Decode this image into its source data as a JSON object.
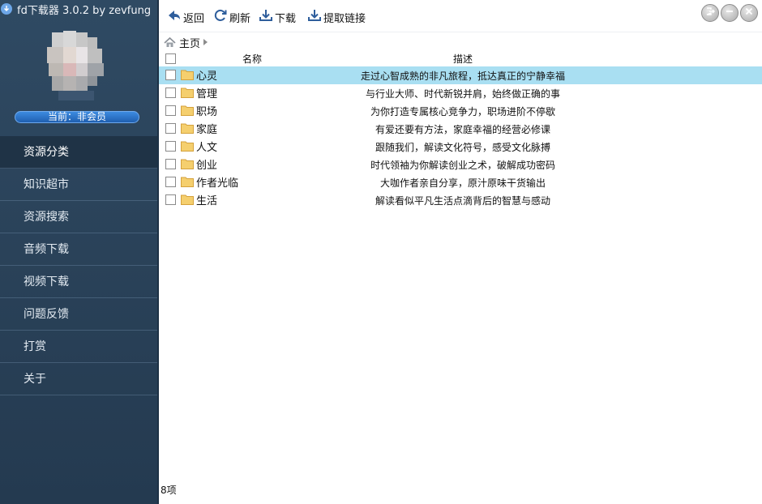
{
  "app": {
    "title": "fd下载器 3.0.2 by zevfung",
    "member_status": "当前：非会员"
  },
  "sidebar": {
    "items": [
      {
        "label": "资源分类",
        "active": true
      },
      {
        "label": "知识超市",
        "active": false
      },
      {
        "label": "资源搜索",
        "active": false
      },
      {
        "label": "音频下载",
        "active": false
      },
      {
        "label": "视频下载",
        "active": false
      },
      {
        "label": "问题反馈",
        "active": false
      },
      {
        "label": "打赏",
        "active": false
      },
      {
        "label": "关于",
        "active": false
      }
    ]
  },
  "toolbar": {
    "back_label": "返回",
    "refresh_label": "刷新",
    "download_label": "下载",
    "extract_label": "提取链接"
  },
  "breadcrumb": {
    "home_label": "主页"
  },
  "table": {
    "columns": [
      "名称",
      "描述"
    ],
    "rows": [
      {
        "name": "心灵",
        "desc": "走过心智成熟的非凡旅程，抵达真正的宁静幸福",
        "selected": true
      },
      {
        "name": "管理",
        "desc": "与行业大师、时代新锐并肩，始终做正确的事",
        "selected": false
      },
      {
        "name": "职场",
        "desc": "为你打造专属核心竞争力，职场进阶不停歇",
        "selected": false
      },
      {
        "name": "家庭",
        "desc": "有爱还要有方法，家庭幸福的经营必修课",
        "selected": false
      },
      {
        "name": "人文",
        "desc": "跟随我们，解读文化符号，感受文化脉搏",
        "selected": false
      },
      {
        "name": "创业",
        "desc": "时代领袖为你解读创业之术，破解成功密码",
        "selected": false
      },
      {
        "name": "作者光临",
        "desc": "大咖作者亲自分享，原汁原味干货输出",
        "selected": false
      },
      {
        "name": "生活",
        "desc": "解读看似平凡生活点滴背后的智慧与感动",
        "selected": false
      }
    ]
  },
  "status": {
    "count_label": "8项"
  },
  "colors": {
    "sidebar_bg": "#2a4259",
    "nav_active": "#1f3346",
    "row_selected": "#a9dff2",
    "folder": "#f3c866",
    "badge": "#2a6fc4"
  }
}
